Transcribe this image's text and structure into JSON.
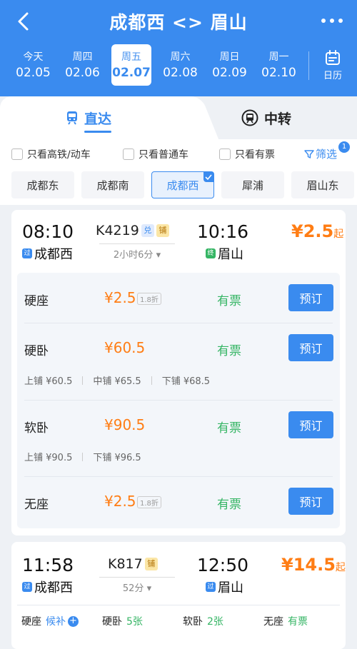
{
  "header": {
    "title": "成都西 <> 眉山",
    "dates": [
      {
        "weekday": "今天",
        "date": "02.05"
      },
      {
        "weekday": "周四",
        "date": "02.06"
      },
      {
        "weekday": "周五",
        "date": "02.07"
      },
      {
        "weekday": "周六",
        "date": "02.08"
      },
      {
        "weekday": "周日",
        "date": "02.09"
      },
      {
        "weekday": "周一",
        "date": "02.10"
      }
    ],
    "calendar_label": "日历"
  },
  "tabs": {
    "direct": "直达",
    "transfer": "中转"
  },
  "filters": {
    "high_speed": "只看高铁/动车",
    "normal": "只看普通车",
    "available": "只看有票",
    "screen": "筛选",
    "screen_count": "1",
    "stations": [
      "成都东",
      "成都南",
      "成都西",
      "犀浦",
      "眉山东"
    ]
  },
  "trains": [
    {
      "depart_time": "08:10",
      "depart_tag": "过",
      "depart_station": "成都西",
      "number": "K4219",
      "badge1": "兑",
      "badge2": "铺",
      "duration": "2小时6分",
      "arrive_time": "10:16",
      "arrive_tag": "终",
      "arrive_station": "眉山",
      "price": "¥2.5",
      "price_suffix": "起",
      "seats": [
        {
          "name": "硬座",
          "price": "¥2.5",
          "discount": "1.8折",
          "status": "有票",
          "button": "预订"
        },
        {
          "name": "硬卧",
          "price": "¥60.5",
          "status": "有票",
          "button": "预订",
          "berths": [
            "上铺 ¥60.5",
            "中铺 ¥65.5",
            "下铺 ¥68.5"
          ]
        },
        {
          "name": "软卧",
          "price": "¥90.5",
          "status": "有票",
          "button": "预订",
          "berths": [
            "上铺 ¥90.5",
            "下铺 ¥96.5"
          ]
        },
        {
          "name": "无座",
          "price": "¥2.5",
          "discount": "1.8折",
          "status": "有票",
          "button": "预订"
        }
      ]
    },
    {
      "depart_time": "11:58",
      "depart_tag": "过",
      "depart_station": "成都西",
      "number": "K817",
      "badge2": "铺",
      "duration": "52分",
      "arrive_time": "12:50",
      "arrive_tag": "过",
      "arrive_station": "眉山",
      "price": "¥14.5",
      "price_suffix": "起",
      "summary": [
        {
          "name": "硬座",
          "value": "候补"
        },
        {
          "name": "硬卧",
          "value": "5张"
        },
        {
          "name": "软卧",
          "value": "2张"
        },
        {
          "name": "无座",
          "value": "有票"
        }
      ]
    }
  ],
  "colors": {
    "primary": "#3a8bef",
    "price": "#ff7d14",
    "available": "#35b564"
  }
}
